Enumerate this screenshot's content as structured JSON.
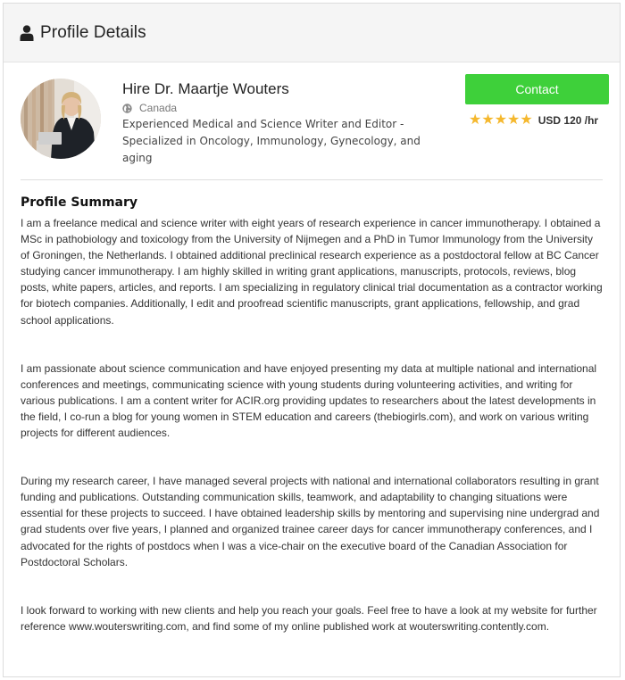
{
  "header": {
    "title": "Profile Details",
    "icon": "user-icon"
  },
  "profile": {
    "name": "Hire Dr. Maartje Wouters",
    "location": "Canada",
    "tagline": "Experienced Medical and Science Writer and Editor - Specialized in Oncology, Immunology, Gynecology, and aging",
    "contact_label": "Contact",
    "rating_stars": 5,
    "rate": "USD 120 /hr",
    "colors": {
      "contact_button": "#3ed03a",
      "stars": "#f5b82e"
    }
  },
  "summary": {
    "heading": "Profile Summary",
    "paragraphs": [
      " I am a freelance medical and science writer with eight years of research experience in cancer immunotherapy. I obtained a MSc in pathobiology and toxicology from the University of Nijmegen and a PhD in Tumor Immunology from the University of Groningen, the Netherlands. I obtained additional preclinical research experience as a postdoctoral fellow at BC Cancer studying cancer immunotherapy. I am highly skilled in writing grant applications, manuscripts, protocols, reviews, blog posts, white papers, articles, and reports. I am specializing in regulatory clinical trial documentation as a contractor working for biotech companies. Additionally, I edit and proofread scientific manuscripts, grant applications, fellowship, and grad school applications.",
      "I am passionate about science communication and have enjoyed presenting my data at multiple national and international conferences and meetings, communicating science with young students during volunteering activities, and writing for various publications. I am a content writer for ACIR.org providing updates to researchers about the latest developments in the field, I co-run a blog for young women in STEM education and careers (thebiogirls.com), and work on various writing projects for different audiences.",
      "During my research career, I have managed several projects with national and international collaborators resulting in grant funding and publications. Outstanding communication skills, teamwork, and adaptability to changing situations were essential for these projects to succeed. I have obtained leadership skills by mentoring and supervising nine undergrad and grad students over five years, I planned and organized trainee career days for cancer immunotherapy conferences, and I advocated for the rights of postdocs when I was a vice-chair on the executive board of the Canadian Association for Postdoctoral Scholars.",
      "I look forward to working with new clients and help you reach your goals. Feel free to have a look at my website for further reference  www.wouterswriting.com, and find some of my online published work at wouterswriting.contently.com."
    ]
  }
}
